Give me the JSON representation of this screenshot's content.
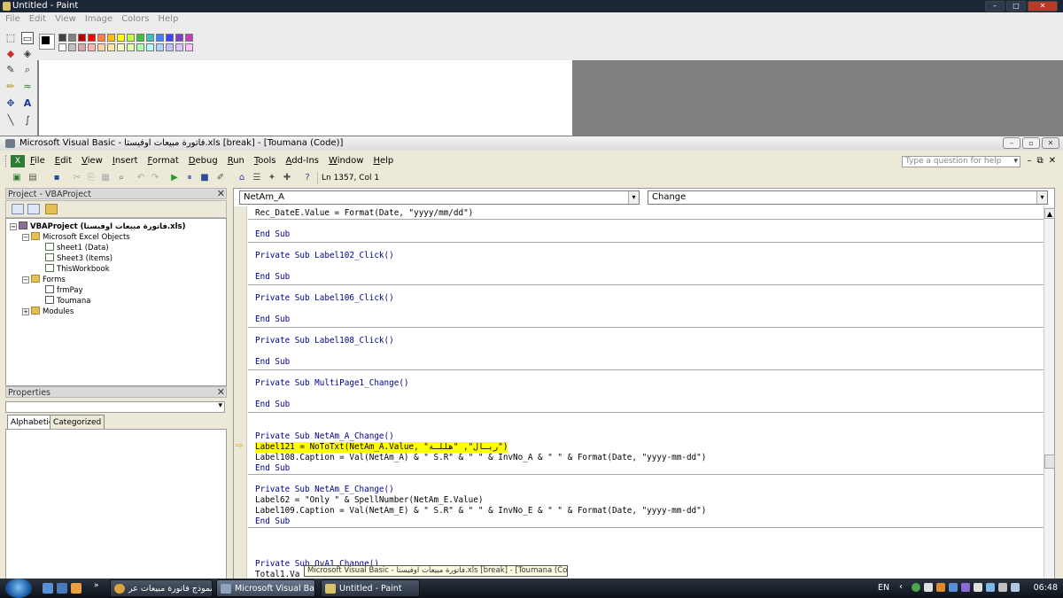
{
  "paint": {
    "title": "Untitled - Paint",
    "menu": [
      "File",
      "Edit",
      "View",
      "Image",
      "Colors",
      "Help"
    ],
    "palette_top": [
      "#000000",
      "#808080",
      "#800000",
      "#808000",
      "#008000",
      "#008080",
      "#000080",
      "#800080",
      "#808040",
      "#004040",
      "#0080ff",
      "#004080",
      "#8000ff",
      "#804000",
      "#ff0000",
      "#ff8000"
    ],
    "palette_top_row": [
      "#404040",
      "#808080",
      "#c00000",
      "#ff0000",
      "#ff8040",
      "#ffc000",
      "#ffff00",
      "#c0ff40",
      "#40c040",
      "#40c0c0",
      "#4080ff",
      "#4040ff",
      "#8040c0",
      "#c040c0"
    ],
    "palette_bottom_row": [
      "#ffffff",
      "#c0c0c0",
      "#d8a8a8",
      "#ffb0b0",
      "#ffd0a0",
      "#ffe8a0",
      "#ffffc0",
      "#e0ffb0",
      "#b0ffb0",
      "#b0ffff",
      "#b0d0ff",
      "#c0c0ff",
      "#e0c0ff",
      "#ffc0ff"
    ]
  },
  "vb": {
    "title": "Microsoft Visual Basic - فاتورة مبيعات اوفيستا.xls [break] - [Toumana (Code)]",
    "menu": [
      "File",
      "Edit",
      "View",
      "Insert",
      "Format",
      "Debug",
      "Run",
      "Tools",
      "Add-Ins",
      "Window",
      "Help"
    ],
    "help_placeholder": "Type a question for help",
    "cursor_position": "Ln 1357, Col 1",
    "project_pane_title": "Project - VBAProject",
    "properties_pane_title": "Properties",
    "tree": [
      {
        "label": "VBAProject (فاتورة مبيعات اوفيستا.xls)",
        "icon": "proj",
        "bold": true
      },
      {
        "label": "Microsoft Excel Objects",
        "icon": "folder"
      },
      {
        "label": "sheet1 (Data)",
        "icon": "sheet"
      },
      {
        "label": "Sheet3 (Items)",
        "icon": "sheet"
      },
      {
        "label": "ThisWorkbook",
        "icon": "sheet"
      },
      {
        "label": "Forms",
        "icon": "folder"
      },
      {
        "label": "frmPay",
        "icon": "form"
      },
      {
        "label": "Toumana",
        "icon": "form"
      },
      {
        "label": "Modules",
        "icon": "folder"
      }
    ],
    "prop_tabs": [
      "Alphabetic",
      "Categorized"
    ],
    "object_combo": "NetAm_A",
    "procedure_combo": "Change",
    "code_lines": [
      "Rec_DateE.Value = Format(Date, \"yyyy/mm/dd\")",
      "End Sub",
      "Private Sub Label102_Click()",
      "End Sub",
      "Private Sub Label106_Click()",
      "End Sub",
      "Private Sub Label108_Click()",
      "End Sub",
      "Private Sub MultiPage1_Change()",
      "End Sub",
      "Private Sub NetAm_A_Change()",
      "Label121 = NoToTxt(NetAm_A.Value, \"ريـال\", \"هللـة\")",
      "Label108.Caption = Val(NetAm_A) & \" S.R\" & \" \" & InvNo_A & \" \" & Format(Date, \"yyyy-mm-dd\")",
      "End Sub",
      "Private Sub NetAm_E_Change()",
      "Label62 = \"Only \" & SpellNumber(NetAm_E.Value)",
      "Label109.Caption = Val(NetAm_E) & \" S.R\" & \" \" & InvNo_E & \" \" & Format(Date, \"yyyy-mm-dd\")",
      "End Sub",
      "Private Sub OvA1_Change()",
      "Total1.Va"
    ]
  },
  "tooltip": "Microsoft Visual Basic - فاتورة مبيعات اوفيستا.xls [break] - [Toumana (Code)]",
  "taskbar": {
    "buttons": [
      "نموذج فاتورة مبيعات عر...",
      "Microsoft Visual Bas...",
      "Untitled - Paint"
    ],
    "lang": "EN",
    "clock": "06:48"
  },
  "colors": {
    "highlight": "#ffff00",
    "keyword": "#00008b"
  }
}
